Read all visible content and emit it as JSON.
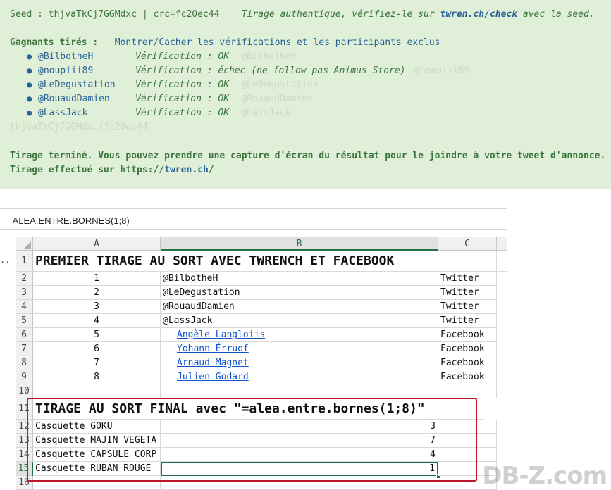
{
  "twren": {
    "seed_line": "Seed : thjvaTkCj7GGMdxc | crc=fc20ec44",
    "authentic_text": "Tirage authentique, vérifiez-le sur ",
    "check_link": "twren.ch/check",
    "authentic_suffix": " avec la seed.",
    "winners_label": "Gagnants tirés :",
    "toggle_link": "Montrer/Cacher les vérifications et les participants exclus",
    "winners": [
      {
        "name": "@BilbotheH",
        "verification": "Vérification : OK",
        "ghost": "@BilbotheH"
      },
      {
        "name": "@noupiii89",
        "verification": "Vérification : échec (ne follow pas Animus_Store)",
        "ghost": "@noupiii89"
      },
      {
        "name": "@LeDegustation",
        "verification": "Vérification : OK",
        "ghost": "@LeDegustation"
      },
      {
        "name": "@RouaudDamien",
        "verification": "Vérification : OK",
        "ghost": "@RouaudDamien"
      },
      {
        "name": "@LassJack",
        "verification": "Vérification : OK",
        "ghost": "@LassJack"
      }
    ],
    "ghost_seed": "thjvaTkCj7GGMdxc/fc20ec44",
    "finished_text": "Tirage terminé. Vous pouvez prendre une capture d'écran du résultat pour le joindre à votre tweet d'annonce.",
    "done_prefix": "Tirage effectué sur https://",
    "done_link": "twren.ch",
    "done_suffix": "/"
  },
  "excel": {
    "formula": "=ALEA.ENTRE.BORNES(1;8)",
    "columns": [
      "A",
      "B",
      "C"
    ],
    "rows": [
      {
        "num": "1",
        "title": "PREMIER TIRAGE AU SORT AVEC TWRENCH ET FACEBOOK"
      },
      {
        "num": "2",
        "a": "1",
        "b": "@BilbotheH",
        "c": "Twitter"
      },
      {
        "num": "3",
        "a": "2",
        "b": "@LeDegustation",
        "c": "Twitter"
      },
      {
        "num": "4",
        "a": "3",
        "b": "@RouaudDamien",
        "c": "Twitter"
      },
      {
        "num": "5",
        "a": "4",
        "b": "@LassJack",
        "c": "Twitter"
      },
      {
        "num": "6",
        "a": "5",
        "b": "Angèle Langloiis",
        "c": "Facebook"
      },
      {
        "num": "7",
        "a": "6",
        "b": "Yohann Érruof",
        "c": "Facebook"
      },
      {
        "num": "8",
        "a": "7",
        "b": "Arnaud Magnet",
        "c": "Facebook"
      },
      {
        "num": "9",
        "a": "8",
        "b": "Julien Godard",
        "c": "Facebook"
      },
      {
        "num": "10"
      },
      {
        "num": "11",
        "title": "TIRAGE AU SORT FINAL avec \"=alea.entre.bornes(1;8)\""
      },
      {
        "num": "12",
        "a": "Casquette GOKU",
        "b": "3"
      },
      {
        "num": "13",
        "a": "Casquette MAJIN VEGETA",
        "b": "7"
      },
      {
        "num": "14",
        "a": "Casquette CAPSULE CORP",
        "b": "4"
      },
      {
        "num": "15",
        "a": "Casquette RUBAN ROUGE",
        "b": "1"
      },
      {
        "num": "16"
      }
    ],
    "dots": "..",
    "watermark": "DB-Z.com",
    "colors": {
      "selection": "#217346",
      "highlight_box": "#c0142b",
      "panel_bg": "#dfefd8"
    }
  }
}
